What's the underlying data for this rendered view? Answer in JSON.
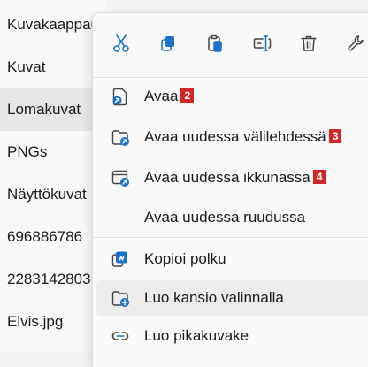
{
  "files": [
    {
      "name": "Kuvakaappaukset"
    },
    {
      "name": "Kuvat"
    },
    {
      "name": "Lomakuvat"
    },
    {
      "name": "PNGs"
    },
    {
      "name": "Näyttökuvat"
    },
    {
      "name": "696886786"
    },
    {
      "name": "2283142803"
    },
    {
      "name": "Elvis.jpg"
    }
  ],
  "toolbar": {
    "icons": [
      "cut-icon",
      "copy-icon",
      "paste-icon",
      "rename-icon",
      "delete-icon",
      "settings-icon"
    ]
  },
  "menu": {
    "open": {
      "label": "Avaa",
      "badge": "2"
    },
    "open_new_tab": {
      "label": "Avaa uudessa välilehdessä",
      "badge": "3"
    },
    "open_new_window": {
      "label": "Avaa uudessa ikkunassa",
      "badge": "4"
    },
    "open_new_pane": {
      "label": "Avaa uudessa ruudussa"
    },
    "copy_path": {
      "label": "Kopioi polku"
    },
    "new_folder_with_selection": {
      "label": "Luo kansio valinnalla"
    },
    "create_shortcut": {
      "label": "Luo pikakuvake"
    }
  },
  "colors": {
    "accent": "#1a73c9",
    "badge": "#d32626"
  }
}
